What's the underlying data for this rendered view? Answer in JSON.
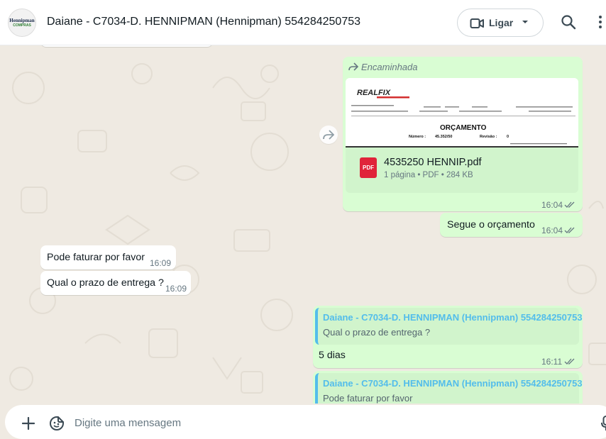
{
  "header": {
    "avatar_line1": "Hennipman",
    "avatar_line2": "COMPRAS",
    "title": "Daiane - C7034-D. HENNIPMAN (Hennipman) 554284250753",
    "call_label": "Ligar"
  },
  "messages": {
    "forwarded": {
      "label": "Encaminhada",
      "preview_brand": "REALFIX",
      "preview_heading": "ORÇAMENTO",
      "preview_number_label": "Número :",
      "preview_number": "45.352/50",
      "preview_revision_label": "Revisão :",
      "preview_revision": "0",
      "file_name": "4535250 HENNIP.pdf",
      "file_meta": "1 página • PDF • 284 KB",
      "pdf_badge": "PDF",
      "time": "16:04"
    },
    "out1": {
      "text": "Segue  o orçamento",
      "time": "16:04"
    },
    "in1": {
      "text": "Pode faturar por favor",
      "time": "16:09"
    },
    "in2": {
      "text": "Qual o prazo de entrega ?",
      "time": "16:09"
    },
    "reply1": {
      "quote_author": "Daiane - C7034-D. HENNIPMAN (Hennipman) 554284250753",
      "quote_text": "Qual o prazo de entrega ?",
      "text": "5 dias",
      "time": "16:11"
    },
    "reply2": {
      "quote_author": "Daiane - C7034-D. HENNIPMAN (Hennipman) 554284250753",
      "quote_text": "Pode faturar por favor"
    }
  },
  "composer": {
    "placeholder": "Digite uma mensagem"
  },
  "colors": {
    "chat_bg": "#efeae2",
    "outgoing": "#d9fdd3",
    "incoming": "#ffffff",
    "quote_author": "#53bdeb",
    "pdf_red": "#e0243a"
  }
}
